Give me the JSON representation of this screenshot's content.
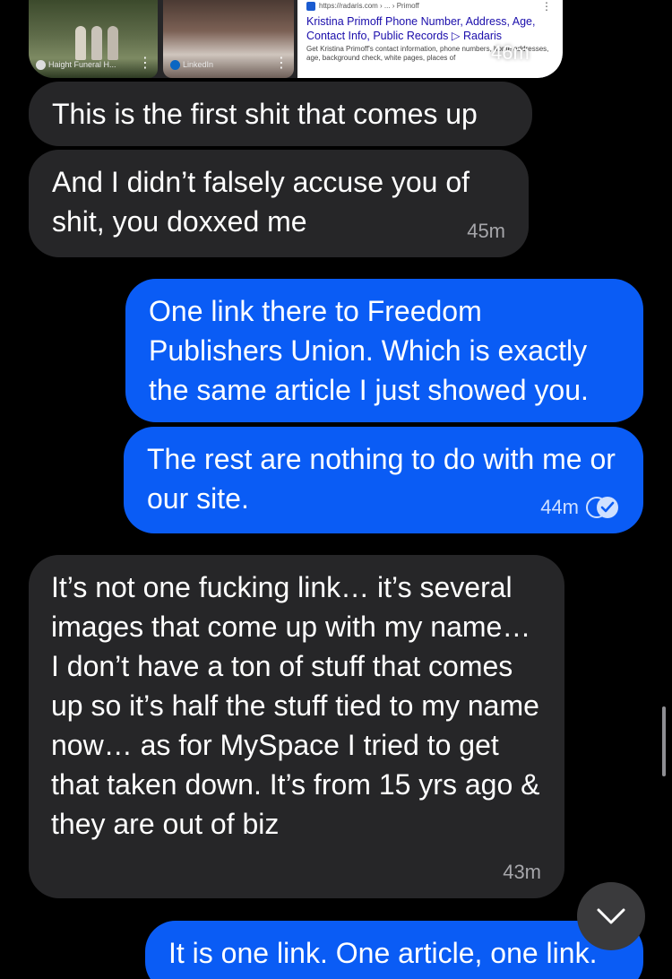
{
  "media_preview": {
    "thumb1_caption": "Haight Funeral H...",
    "thumb2_caption": "LinkedIn",
    "card_url": "https://radaris.com › ... › Primoff",
    "card_title": "Kristina Primoff Phone Number, Address, Age, Contact Info, Public Records ▷ Radaris",
    "card_description": "Get Kristina Primoff's contact information, phone numbers, home addresses, age, background check, white pages, places of",
    "time": "46m"
  },
  "messages": [
    {
      "direction": "incoming",
      "text": "This is the first shit that comes up",
      "time": ""
    },
    {
      "direction": "incoming",
      "text": "And I didn’t falsely accuse you of shit, you doxxed me",
      "time": "45m"
    },
    {
      "direction": "outgoing",
      "text": "One link there to Freedom Publishers Union. Which is exactly the same article I just showed you.",
      "time": ""
    },
    {
      "direction": "outgoing",
      "text": "The rest are nothing to do with me or our site.",
      "time": "44m",
      "read": true
    },
    {
      "direction": "incoming",
      "text": "It’s not one fucking link… it’s several images that come up with my name… I don’t have a ton of stuff that comes up so it’s half the stuff tied to my name now… as for MySpace I tried to get that taken down. It’s from 15 yrs ago & they are out of biz",
      "time": "43m"
    },
    {
      "direction": "outgoing",
      "text": "It is one link. One article, one link.",
      "time": ""
    }
  ],
  "icons": {
    "read_receipt": "read-receipt-icon",
    "scroll_down": "chevron-down-icon",
    "more": "more-vertical-icon"
  },
  "colors": {
    "background": "#000000",
    "incoming_bubble": "#262628",
    "outgoing_bubble": "#0a5cf5"
  }
}
